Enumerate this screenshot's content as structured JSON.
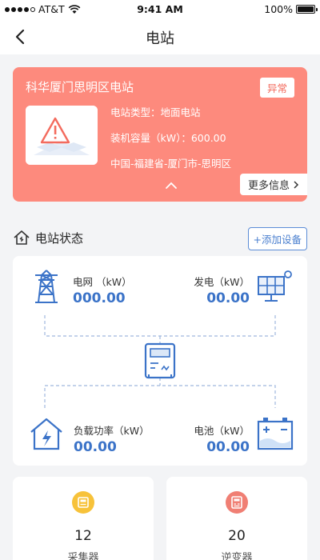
{
  "status_bar": {
    "carrier": "AT&T",
    "time": "9:41 AM",
    "battery": "100%"
  },
  "nav": {
    "title": "电站"
  },
  "station": {
    "name": "科华厦门思明区电站",
    "status": "异常",
    "type": "电站类型：地面电站",
    "capacity": "装机容量（kW）：600.00",
    "location": "中国-福建省-厦门市-思明区",
    "more_label": "更多信息"
  },
  "status_section": {
    "title": "电站状态",
    "add_device_label": "添加设备"
  },
  "flow": {
    "grid": {
      "label": "电网 （kW）",
      "value": "000.00"
    },
    "generation": {
      "label": "发电（kW）",
      "value": "00.00"
    },
    "load": {
      "label": "负载功率（kW）",
      "value": "00.00"
    },
    "battery": {
      "label": "电池（kW）",
      "value": "00.00"
    }
  },
  "devices": [
    {
      "count": "12",
      "name": "采集器"
    },
    {
      "count": "20",
      "name": "逆变器"
    }
  ],
  "colors": {
    "card_bg": "#fd8a7d",
    "accent_blue": "#3b73c8",
    "status_red": "#f36b5e",
    "collector_yellow": "#f7c23a",
    "inverter_red": "#f07f74"
  }
}
